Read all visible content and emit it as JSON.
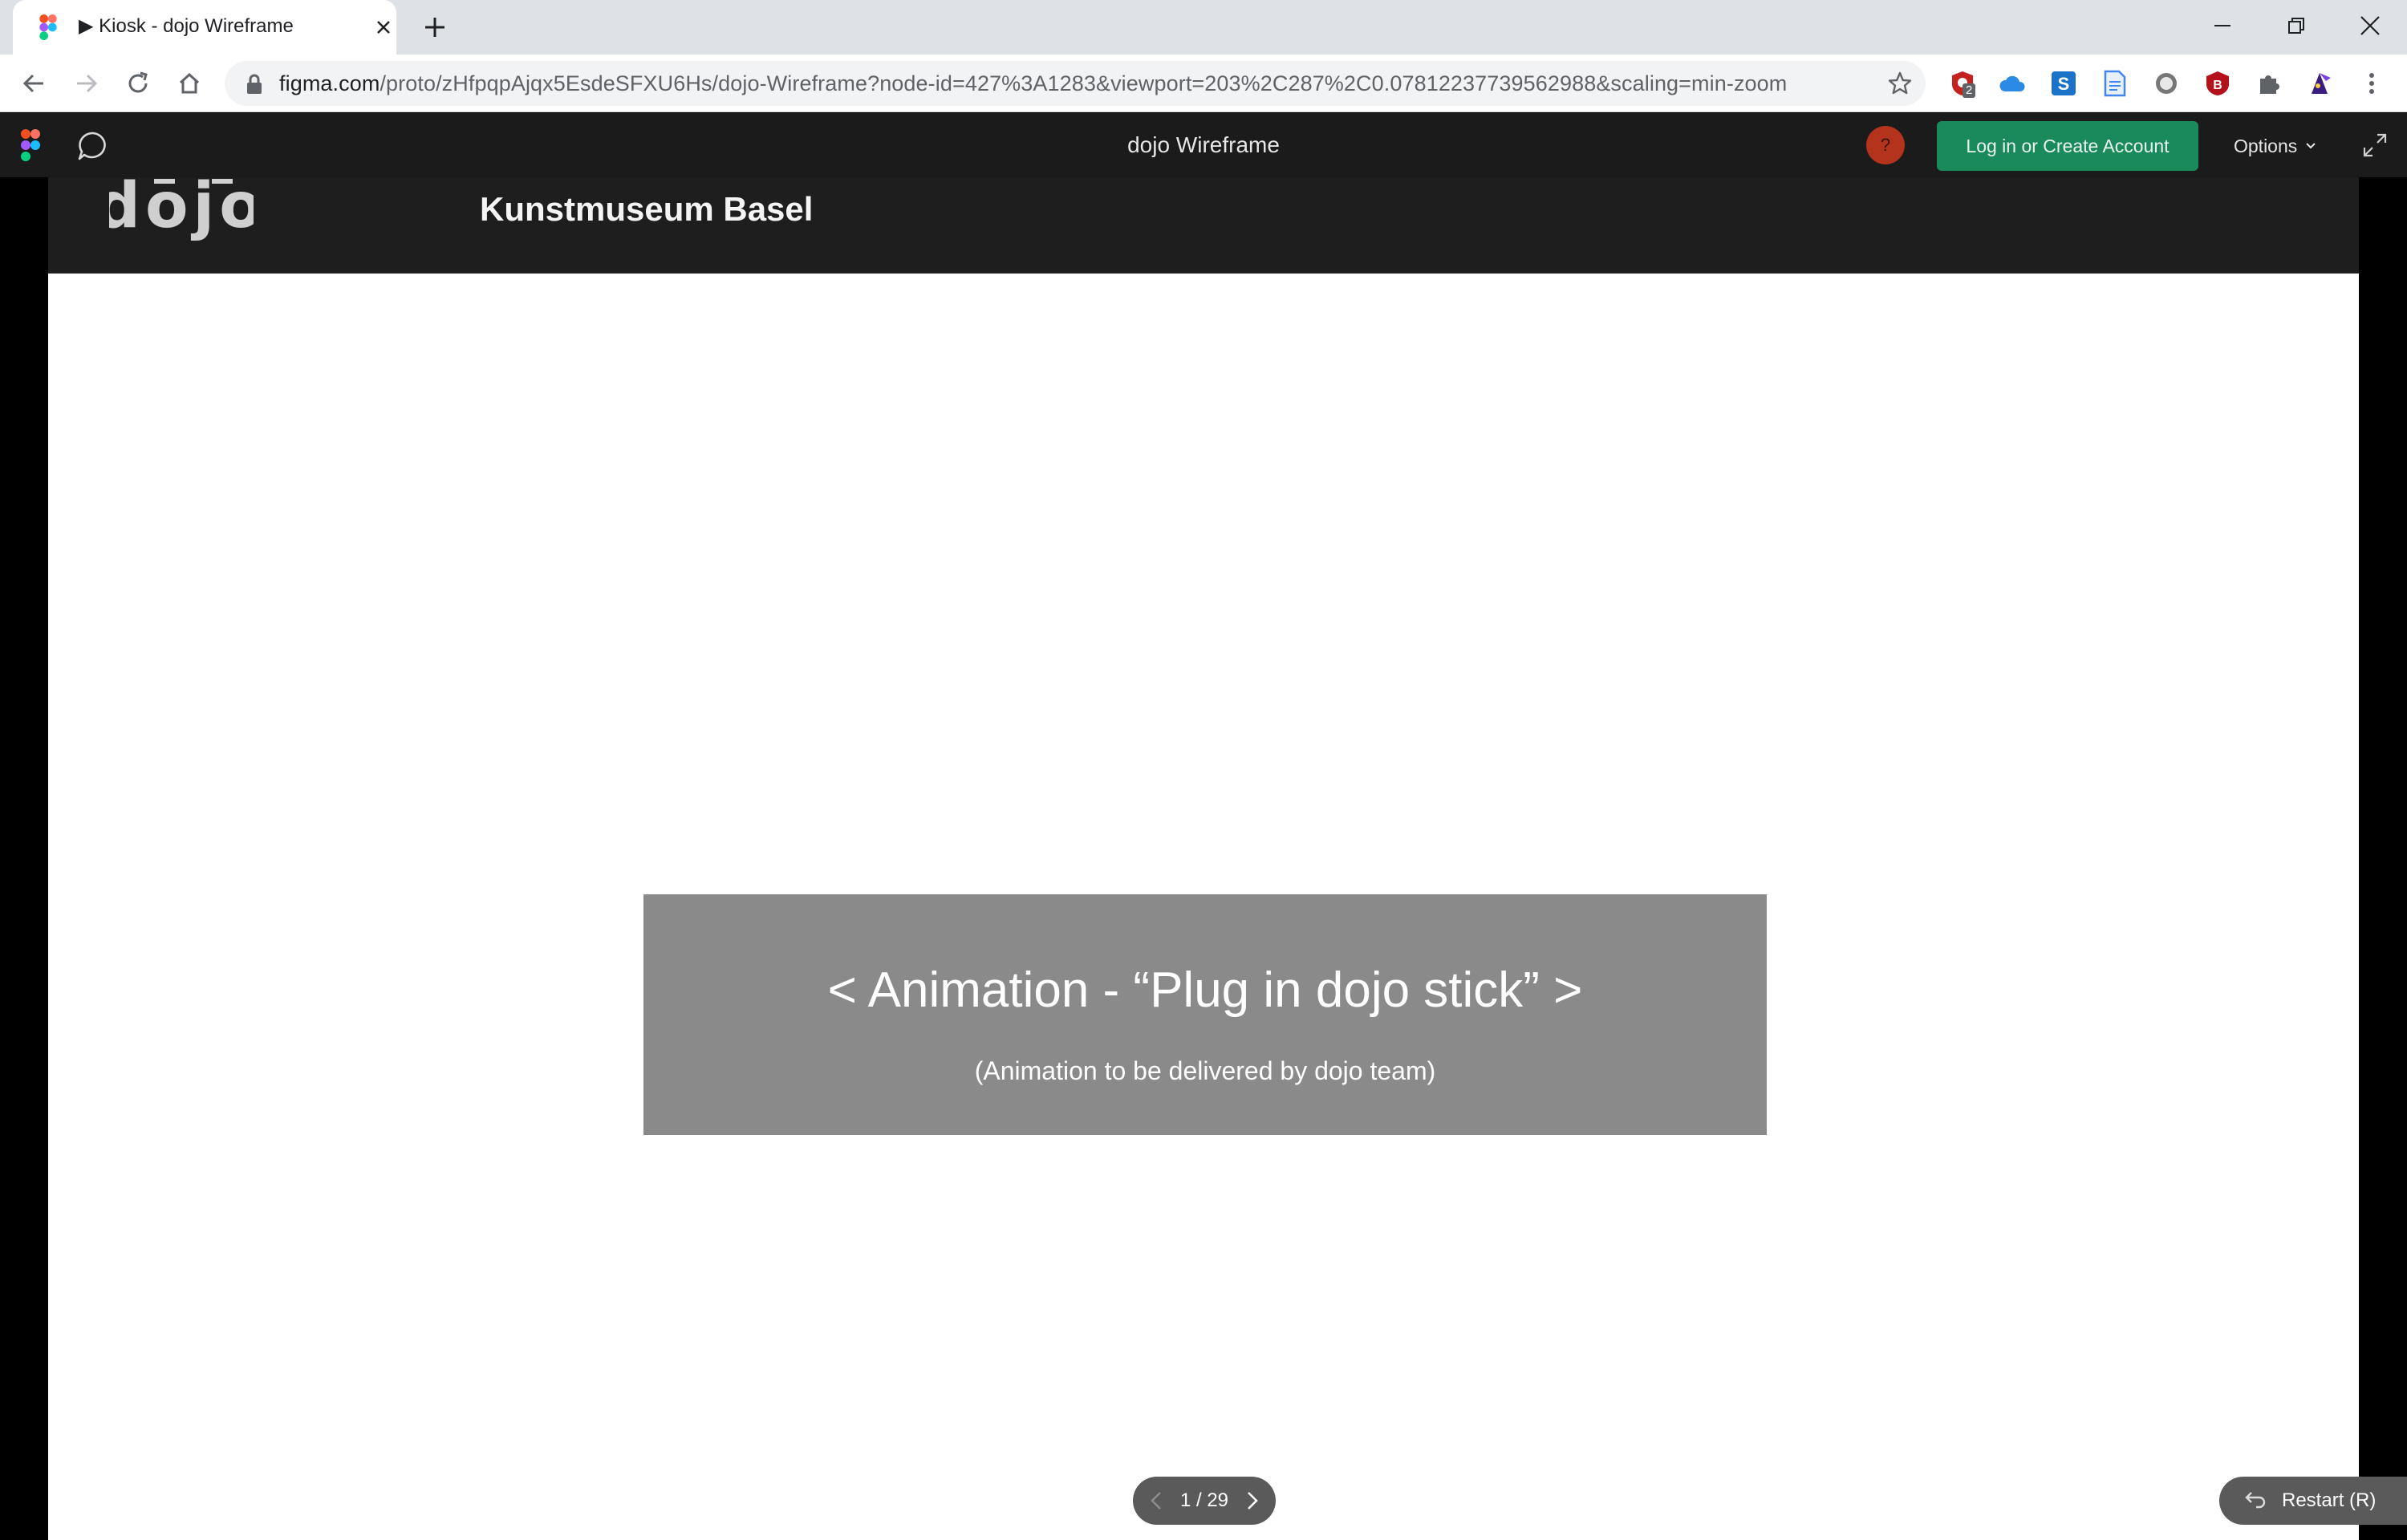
{
  "browser": {
    "tab": {
      "title": "▶ Kiosk - dojo Wireframe"
    },
    "address": {
      "host": "figma.com",
      "path": "/proto/zHfpqpAjqx5EsdeSFXU6Hs/dojo-Wireframe?node-id=427%3A1283&viewport=203%2C287%2C0.07812237739562988&scaling=min-zoom"
    },
    "extension_badge": "2"
  },
  "viewer": {
    "title": "dojo Wireframe",
    "help_label": "?",
    "login_label": "Log in or Create Account",
    "options_label": "Options",
    "accent_color": "#1b8a5a"
  },
  "frame": {
    "logo_text": "dojo",
    "museum_name": "Kunstmuseum Basel",
    "placeholder": {
      "title": "< Animation - “Plug in dojo stick” >",
      "subtitle": "(Animation to be delivered by dojo team)"
    }
  },
  "controls": {
    "page_indicator": "1 / 29",
    "restart_label": "Restart (R)"
  },
  "icons": [
    "figma-favicon",
    "close-icon",
    "plus-icon",
    "minimize-icon",
    "maximize-icon",
    "window-close-icon",
    "back-arrow-icon",
    "forward-arrow-icon",
    "reload-icon",
    "home-icon",
    "lock-icon",
    "star-icon",
    "comment-icon",
    "expand-icon",
    "chevron-left-icon",
    "chevron-right-icon",
    "restart-icon"
  ]
}
